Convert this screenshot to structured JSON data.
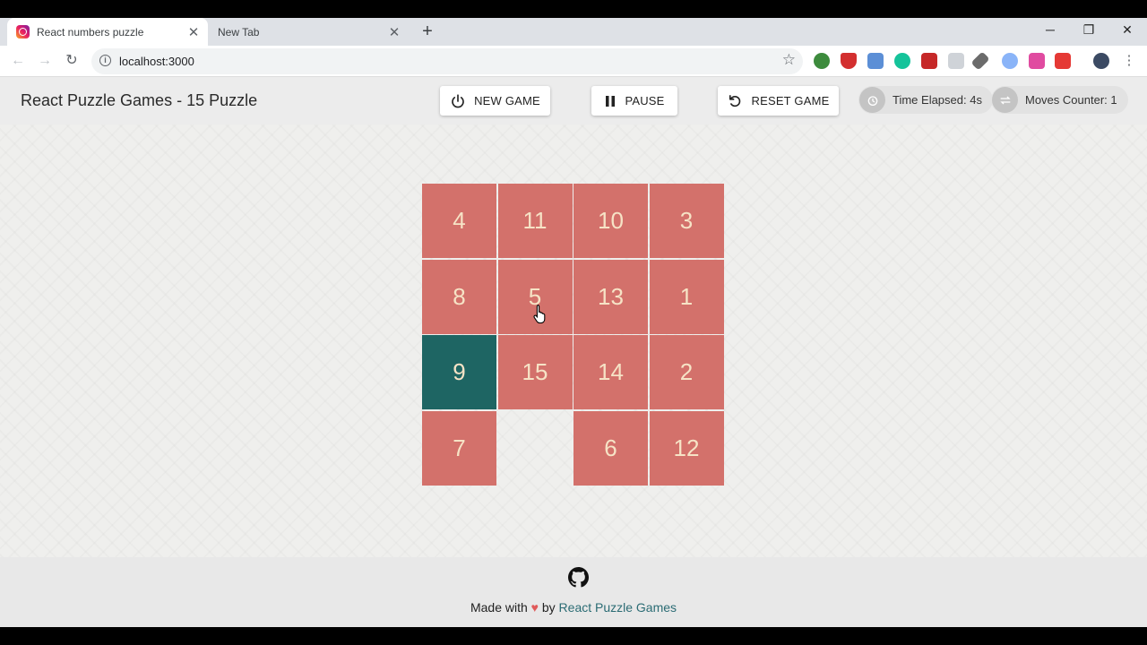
{
  "browser": {
    "tabs": [
      {
        "title": "React numbers puzzle",
        "active": true
      },
      {
        "title": "New Tab",
        "active": false
      }
    ],
    "address": "localhost:3000",
    "window_controls": {
      "minimize": "─",
      "restore": "❐",
      "close": "✕"
    }
  },
  "app": {
    "title": "React Puzzle Games - 15 Puzzle",
    "buttons": {
      "new_game": "NEW GAME",
      "pause": "PAUSE",
      "reset_game": "RESET GAME"
    },
    "time_elapsed": "Time Elapsed: 4s",
    "moves_counter": "Moves Counter: 1"
  },
  "board": {
    "size": 4,
    "highlight_color": "#1e6563",
    "tile_color": "#d3716b",
    "rows": [
      [
        "4",
        "11",
        "10",
        "3"
      ],
      [
        "8",
        "5",
        "13",
        "1"
      ],
      [
        "9",
        "15",
        "14",
        "2"
      ],
      [
        "7",
        "",
        "6",
        "12"
      ]
    ],
    "highlighted": "9"
  },
  "footer": {
    "made_with": "Made with",
    "heart": "♥",
    "by": "by",
    "link": "React Puzzle Games"
  }
}
